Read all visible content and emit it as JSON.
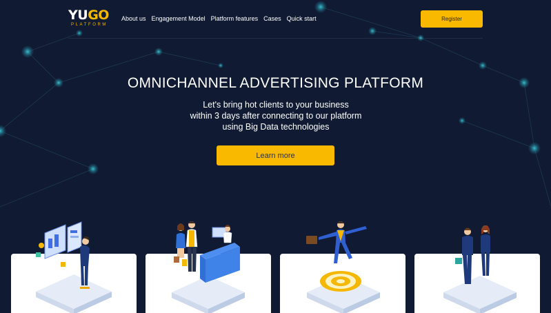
{
  "header": {
    "logo_primary_a": "YU",
    "logo_primary_b": "GO",
    "logo_secondary": "PLATFORM",
    "nav": [
      {
        "label": "About us"
      },
      {
        "label": "Engagement Model"
      },
      {
        "label": "Platform features"
      },
      {
        "label": "Cases"
      },
      {
        "label": "Quick start"
      }
    ],
    "register_label": "Register"
  },
  "hero": {
    "title": "OMNICHANNEL ADVERTISING PLATFORM",
    "subtitle_lines": [
      "Let's bring hot clients to your business",
      "within 3 days after connecting to our platform",
      "using Big Data technologies"
    ],
    "cta_label": "Learn more"
  },
  "cards": [
    {
      "illustration": "analytics-dashboard-illustration"
    },
    {
      "illustration": "customer-service-illustration"
    },
    {
      "illustration": "target-success-illustration"
    },
    {
      "illustration": "business-partners-illustration"
    }
  ],
  "colors": {
    "background": "#101b33",
    "accent": "#f9b900",
    "node": "#2a9bb0"
  }
}
